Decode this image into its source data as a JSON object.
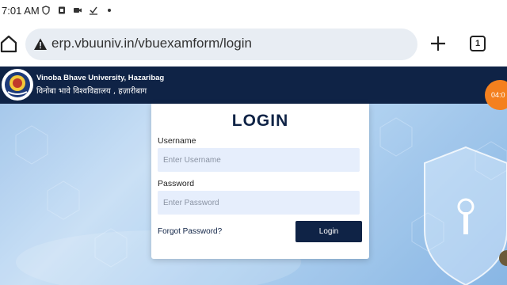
{
  "status_bar": {
    "time": "7:01 AM",
    "icons": [
      "shield-icon",
      "office-icon",
      "video-icon",
      "download-check-icon",
      "dot-icon"
    ]
  },
  "browser": {
    "url": "erp.vbuuniv.in/vbuexamform/login",
    "tab_count": "1",
    "icons": [
      "home-icon",
      "warning-icon",
      "plus-icon",
      "tab-switcher-icon"
    ]
  },
  "site_header": {
    "university_name": "Vinoba Bhave University, Hazaribag",
    "university_name_hindi": "विनोबा भावे विश्वविद्यालय , हज़ारीबाग",
    "background_color": "#0f2346"
  },
  "timer": {
    "text": "04:0"
  },
  "login_form": {
    "title": "LOGIN",
    "username_label": "Username",
    "username_placeholder": "Enter Username",
    "password_label": "Password",
    "password_placeholder": "Enter Password",
    "forgot_password": "Forgot Password?",
    "login_button": "Login"
  },
  "colors": {
    "brand_navy": "#0f2346",
    "input_bg": "#e6eefc",
    "timer_orange": "#f4801e"
  }
}
